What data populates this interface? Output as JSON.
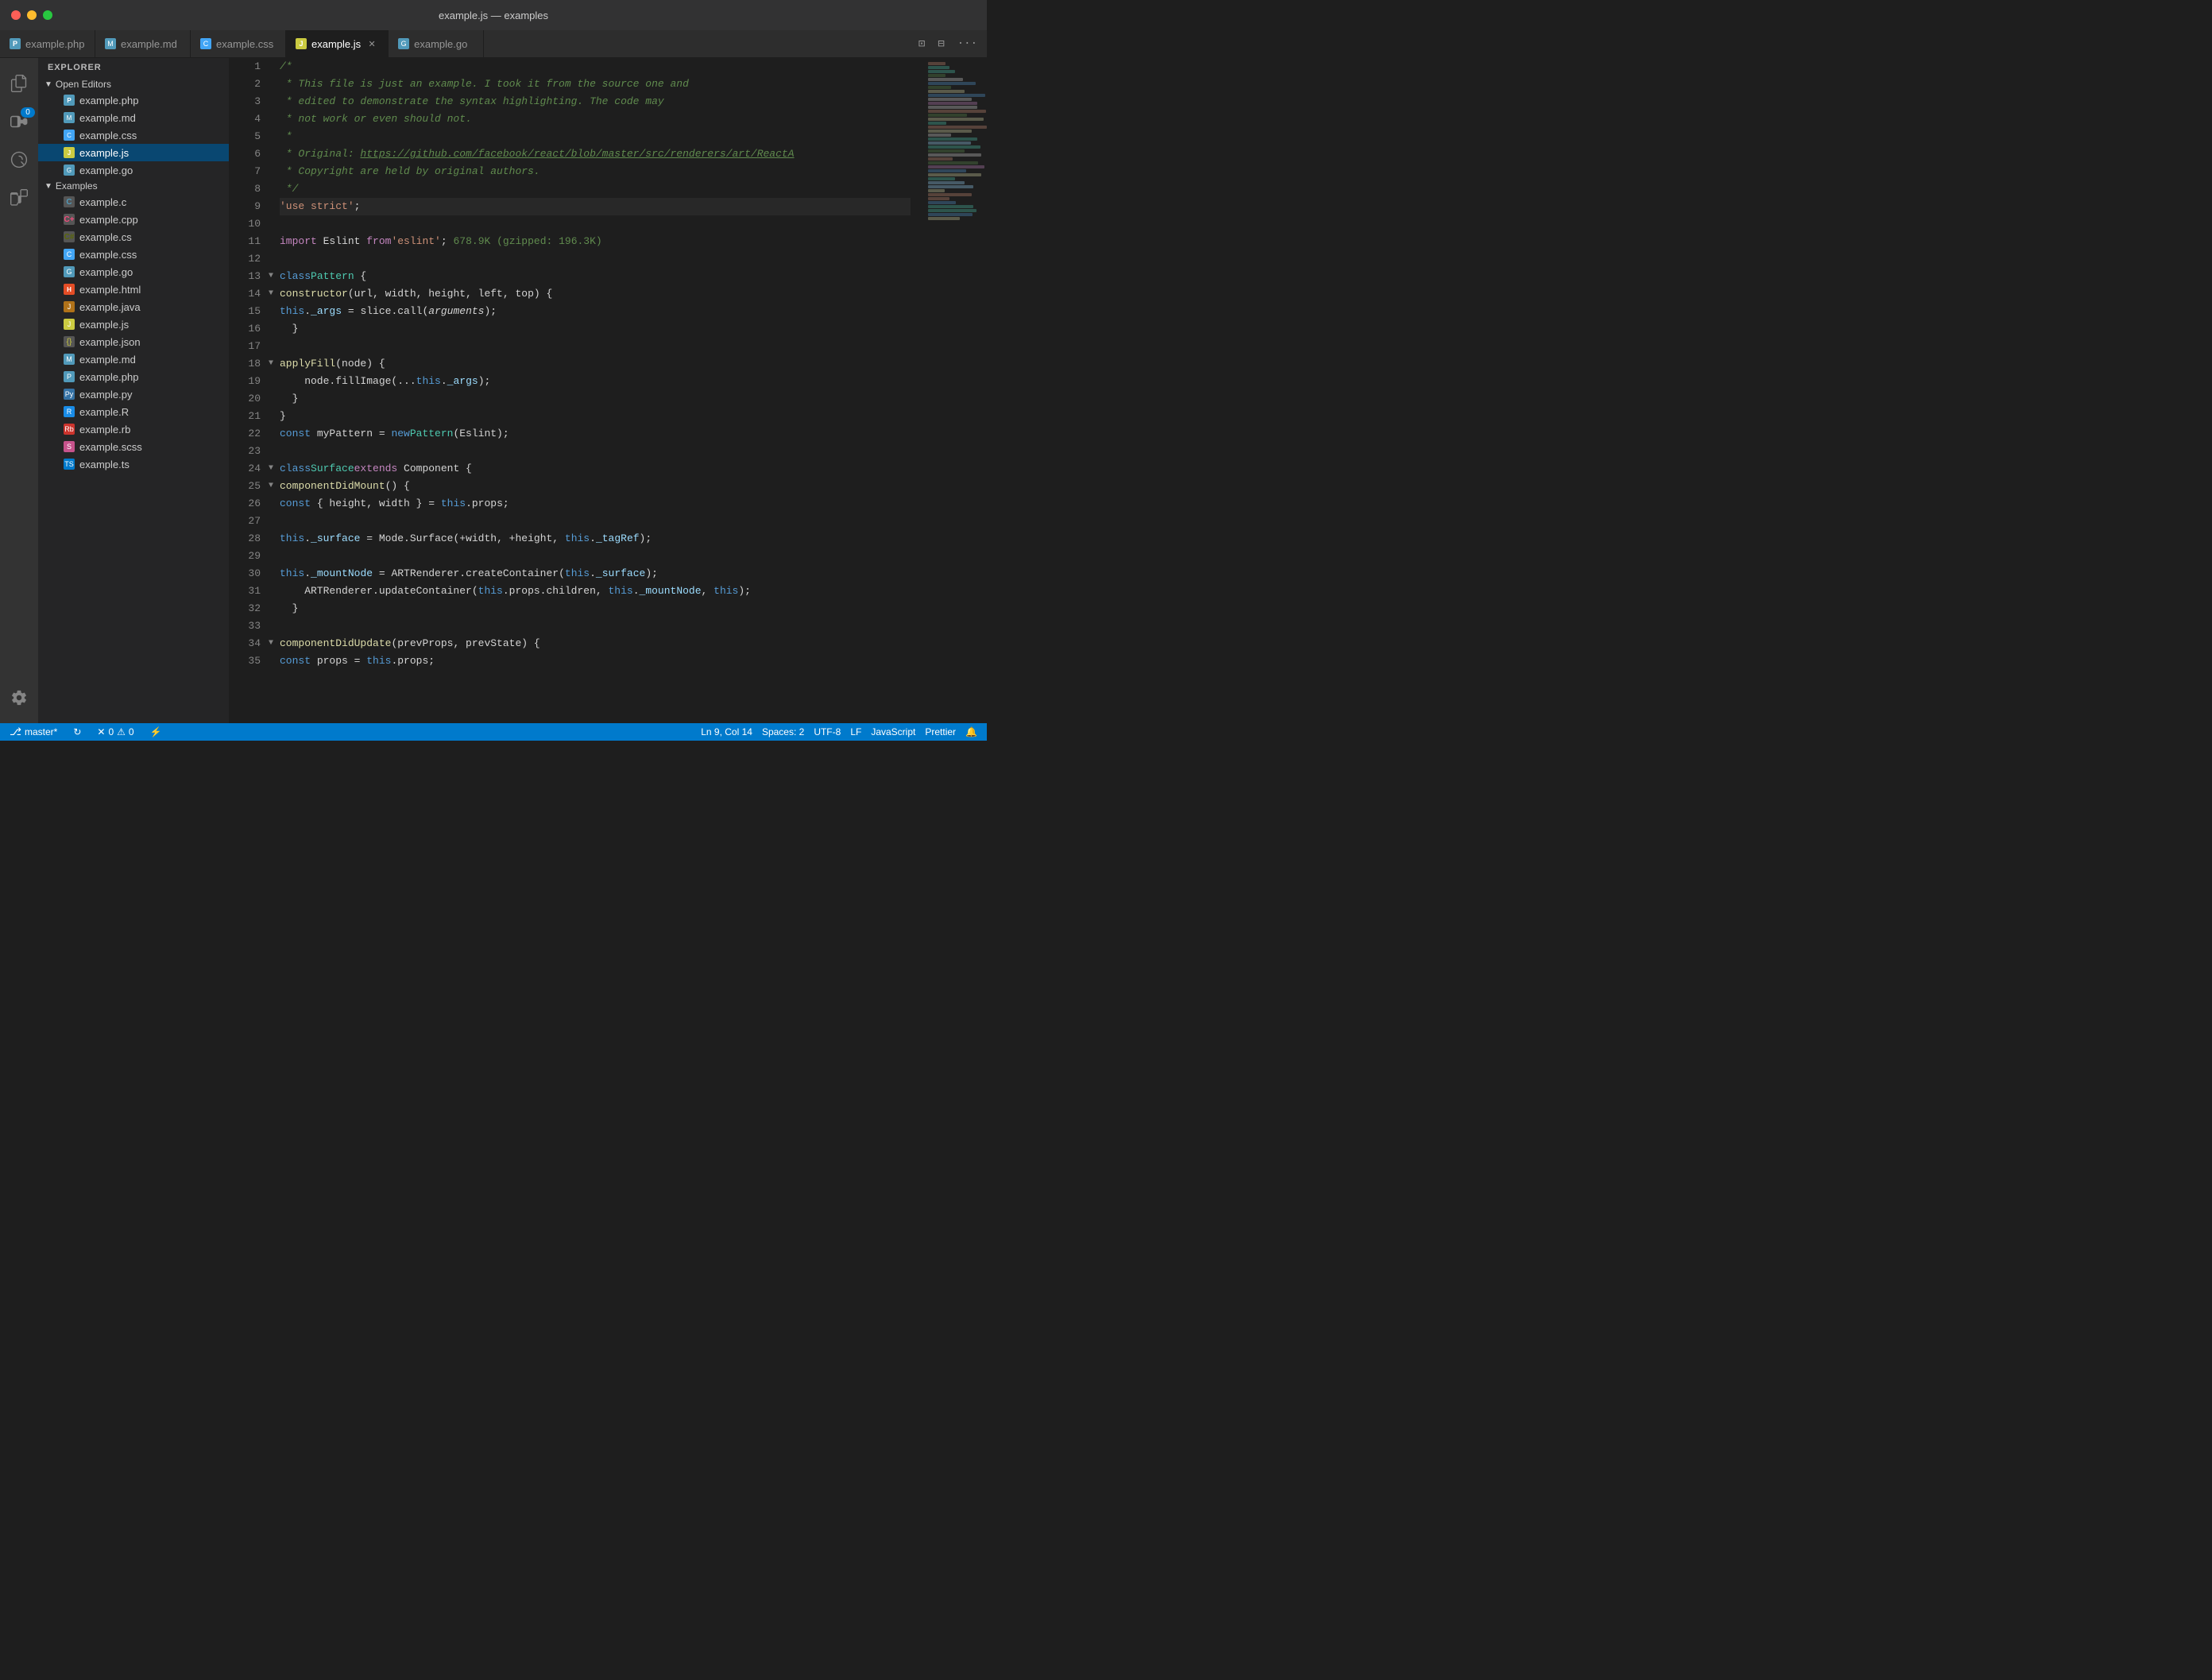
{
  "titlebar": {
    "title": "example.js — examples"
  },
  "tabs": [
    {
      "id": "example-php",
      "label": "example.php",
      "color": "#519aba",
      "icon": "php",
      "active": false,
      "closeable": false
    },
    {
      "id": "example-md",
      "label": "example.md",
      "color": "#519aba",
      "icon": "md",
      "active": false,
      "closeable": false
    },
    {
      "id": "example-css",
      "label": "example.css",
      "color": "#519aba",
      "icon": "css",
      "active": false,
      "closeable": false
    },
    {
      "id": "example-js",
      "label": "example.js",
      "color": "#cbcb41",
      "icon": "js",
      "active": true,
      "closeable": true
    },
    {
      "id": "example-go",
      "label": "example.go",
      "color": "#519aba",
      "icon": "go",
      "active": false,
      "closeable": false
    }
  ],
  "sidebar": {
    "section_label": "Explorer",
    "open_editors_label": "Open Editors",
    "examples_label": "Examples",
    "open_editors": [
      {
        "name": "example.php",
        "color": "#519aba"
      },
      {
        "name": "example.md",
        "color": "#519aba"
      },
      {
        "name": "example.css",
        "color": "#42a5f5"
      },
      {
        "name": "example.js",
        "color": "#cbcb41",
        "active": true
      },
      {
        "name": "example.go",
        "color": "#519aba"
      }
    ],
    "examples": [
      {
        "name": "example.c",
        "color": "#519aba"
      },
      {
        "name": "example.cpp",
        "color": "#f34b7d"
      },
      {
        "name": "example.cs",
        "color": "#596706"
      },
      {
        "name": "example.css",
        "color": "#42a5f5"
      },
      {
        "name": "example.go",
        "color": "#519aba"
      },
      {
        "name": "example.html",
        "color": "#e44d26"
      },
      {
        "name": "example.java",
        "color": "#b07219"
      },
      {
        "name": "example.js",
        "color": "#cbcb41"
      },
      {
        "name": "example.json",
        "color": "#cbcb41"
      },
      {
        "name": "example.md",
        "color": "#519aba"
      },
      {
        "name": "example.php",
        "color": "#519aba"
      },
      {
        "name": "example.py",
        "color": "#3572a5"
      },
      {
        "name": "example.R",
        "color": "#198ce7"
      },
      {
        "name": "example.rb",
        "color": "#cc342d"
      },
      {
        "name": "example.scss",
        "color": "#c6538c"
      },
      {
        "name": "example.ts",
        "color": "#007acc"
      }
    ]
  },
  "editor": {
    "filename": "example.js",
    "lines": [
      {
        "num": 1,
        "tokens": [
          {
            "t": "comment",
            "v": "/*"
          }
        ]
      },
      {
        "num": 2,
        "tokens": [
          {
            "t": "comment",
            "v": " * This file is just an example. I took it from the source one and"
          }
        ]
      },
      {
        "num": 3,
        "tokens": [
          {
            "t": "comment",
            "v": " * edited to demonstrate the syntax highlighting. The code may"
          }
        ]
      },
      {
        "num": 4,
        "tokens": [
          {
            "t": "comment",
            "v": " * not work or even should not."
          }
        ]
      },
      {
        "num": 5,
        "tokens": [
          {
            "t": "comment",
            "v": " *"
          }
        ]
      },
      {
        "num": 6,
        "tokens": [
          {
            "t": "comment-url",
            "v": " * Original: https://github.com/facebook/react/blob/master/src/renderers/art/ReactA"
          }
        ]
      },
      {
        "num": 7,
        "tokens": [
          {
            "t": "comment",
            "v": " * Copyright are held by original authors."
          }
        ]
      },
      {
        "num": 8,
        "tokens": [
          {
            "t": "comment",
            "v": " */"
          }
        ]
      },
      {
        "num": 9,
        "tokens": [
          {
            "t": "string",
            "v": "'use strict'"
          },
          {
            "t": "plain",
            "v": ";"
          }
        ],
        "active": true,
        "git": true
      },
      {
        "num": 10,
        "tokens": []
      },
      {
        "num": 11,
        "tokens": [
          {
            "t": "keyword",
            "v": "import"
          },
          {
            "t": "plain",
            "v": " Eslint "
          },
          {
            "t": "keyword",
            "v": "from"
          },
          {
            "t": "plain",
            "v": " "
          },
          {
            "t": "string",
            "v": "'eslint'"
          },
          {
            "t": "plain",
            "v": "; "
          },
          {
            "t": "size",
            "v": "678.9K (gzipped: 196.3K)"
          }
        ],
        "git": true
      },
      {
        "num": 12,
        "tokens": []
      },
      {
        "num": 13,
        "tokens": [
          {
            "t": "keyword2",
            "v": "class"
          },
          {
            "t": "plain",
            "v": " "
          },
          {
            "t": "classname",
            "v": "Pattern"
          },
          {
            "t": "plain",
            "v": " {"
          }
        ],
        "foldable": true
      },
      {
        "num": 14,
        "tokens": [
          {
            "t": "function",
            "v": "constructor"
          },
          {
            "t": "plain",
            "v": "(url, width, height, left, top) {"
          }
        ],
        "foldable": true,
        "indent": 2
      },
      {
        "num": 15,
        "tokens": [
          {
            "t": "this",
            "v": "this"
          },
          {
            "t": "plain",
            "v": "."
          },
          {
            "t": "property",
            "v": "_args"
          },
          {
            "t": "plain",
            "v": " = slice.call("
          },
          {
            "t": "italic",
            "v": "arguments"
          },
          {
            "t": "plain",
            "v": ");"
          }
        ],
        "indent": 4
      },
      {
        "num": 16,
        "tokens": [
          {
            "t": "plain",
            "v": "}"
          }
        ],
        "indent": 2
      },
      {
        "num": 17,
        "tokens": []
      },
      {
        "num": 18,
        "tokens": [
          {
            "t": "function",
            "v": "applyFill"
          },
          {
            "t": "plain",
            "v": "(node) {"
          }
        ],
        "foldable": true,
        "indent": 2
      },
      {
        "num": 19,
        "tokens": [
          {
            "t": "plain",
            "v": "node.fillImage(..."
          },
          {
            "t": "this",
            "v": "this"
          },
          {
            "t": "plain",
            "v": "."
          },
          {
            "t": "property",
            "v": "_args"
          },
          {
            "t": "plain",
            "v": ");"
          }
        ],
        "indent": 4,
        "git": true
      },
      {
        "num": 20,
        "tokens": [
          {
            "t": "plain",
            "v": "}"
          }
        ],
        "indent": 2
      },
      {
        "num": 21,
        "tokens": [
          {
            "t": "plain",
            "v": "}"
          }
        ]
      },
      {
        "num": 22,
        "tokens": [
          {
            "t": "keyword2",
            "v": "const"
          },
          {
            "t": "plain",
            "v": " myPattern = "
          },
          {
            "t": "keyword2",
            "v": "new"
          },
          {
            "t": "plain",
            "v": " "
          },
          {
            "t": "classname",
            "v": "Pattern"
          },
          {
            "t": "plain",
            "v": "(Eslint);"
          }
        ],
        "git": true
      },
      {
        "num": 23,
        "tokens": []
      },
      {
        "num": 24,
        "tokens": [
          {
            "t": "keyword2",
            "v": "class"
          },
          {
            "t": "plain",
            "v": " "
          },
          {
            "t": "classname",
            "v": "Surface"
          },
          {
            "t": "plain",
            "v": " "
          },
          {
            "t": "keyword",
            "v": "extends"
          },
          {
            "t": "plain",
            "v": " Component {"
          }
        ],
        "foldable": true
      },
      {
        "num": 25,
        "tokens": [
          {
            "t": "function",
            "v": "componentDidMount"
          },
          {
            "t": "plain",
            "v": "() {"
          }
        ],
        "foldable": true,
        "indent": 2
      },
      {
        "num": 26,
        "tokens": [
          {
            "t": "keyword2",
            "v": "const"
          },
          {
            "t": "plain",
            "v": " { height, width } = "
          },
          {
            "t": "this",
            "v": "this"
          },
          {
            "t": "plain",
            "v": ".props;"
          }
        ],
        "indent": 4,
        "git": true
      },
      {
        "num": 27,
        "tokens": []
      },
      {
        "num": 28,
        "tokens": [
          {
            "t": "this",
            "v": "this"
          },
          {
            "t": "plain",
            "v": "."
          },
          {
            "t": "property",
            "v": "_surface"
          },
          {
            "t": "plain",
            "v": " = Mode.Surface(+width, +height, "
          },
          {
            "t": "this",
            "v": "this"
          },
          {
            "t": "plain",
            "v": "."
          },
          {
            "t": "property",
            "v": "_tagRef"
          },
          {
            "t": "plain",
            "v": ");"
          }
        ],
        "indent": 4
      },
      {
        "num": 29,
        "tokens": []
      },
      {
        "num": 30,
        "tokens": [
          {
            "t": "this",
            "v": "this"
          },
          {
            "t": "plain",
            "v": "."
          },
          {
            "t": "property",
            "v": "_mountNode"
          },
          {
            "t": "plain",
            "v": " = ARTRenderer.createContainer("
          },
          {
            "t": "this",
            "v": "this"
          },
          {
            "t": "plain",
            "v": "."
          },
          {
            "t": "property",
            "v": "_surface"
          },
          {
            "t": "plain",
            "v": ");"
          }
        ],
        "indent": 4
      },
      {
        "num": 31,
        "tokens": [
          {
            "t": "plain",
            "v": "ARTRenderer.updateContainer("
          },
          {
            "t": "this",
            "v": "this"
          },
          {
            "t": "plain",
            "v": ".props.children, "
          },
          {
            "t": "this",
            "v": "this"
          },
          {
            "t": "plain",
            "v": "."
          },
          {
            "t": "property",
            "v": "_mountNode"
          },
          {
            "t": "plain",
            "v": ", "
          },
          {
            "t": "this",
            "v": "this"
          },
          {
            "t": "plain",
            "v": ");"
          }
        ],
        "indent": 4
      },
      {
        "num": 32,
        "tokens": [
          {
            "t": "plain",
            "v": "}"
          }
        ],
        "indent": 2
      },
      {
        "num": 33,
        "tokens": []
      },
      {
        "num": 34,
        "tokens": [
          {
            "t": "function",
            "v": "componentDidUpdate"
          },
          {
            "t": "plain",
            "v": "(prevProps, prevState) {"
          }
        ],
        "foldable": true,
        "indent": 2
      },
      {
        "num": 35,
        "tokens": [
          {
            "t": "keyword2",
            "v": "const"
          },
          {
            "t": "plain",
            "v": " props = "
          },
          {
            "t": "this",
            "v": "this"
          },
          {
            "t": "plain",
            "v": ".props;"
          }
        ],
        "indent": 4
      }
    ]
  },
  "statusbar": {
    "branch": "master*",
    "errors": "0",
    "warnings": "0",
    "cursor": "Ln 9, Col 14",
    "spaces": "Spaces: 2",
    "encoding": "UTF-8",
    "lineending": "LF",
    "language": "JavaScript",
    "formatter": "Prettier"
  },
  "icons": {
    "explorer": "⊞",
    "git": "⑆",
    "debug": "⊘",
    "extensions": "⊟",
    "settings": "⚙",
    "branch": "⎇",
    "sync": "↻",
    "bell": "🔔"
  }
}
